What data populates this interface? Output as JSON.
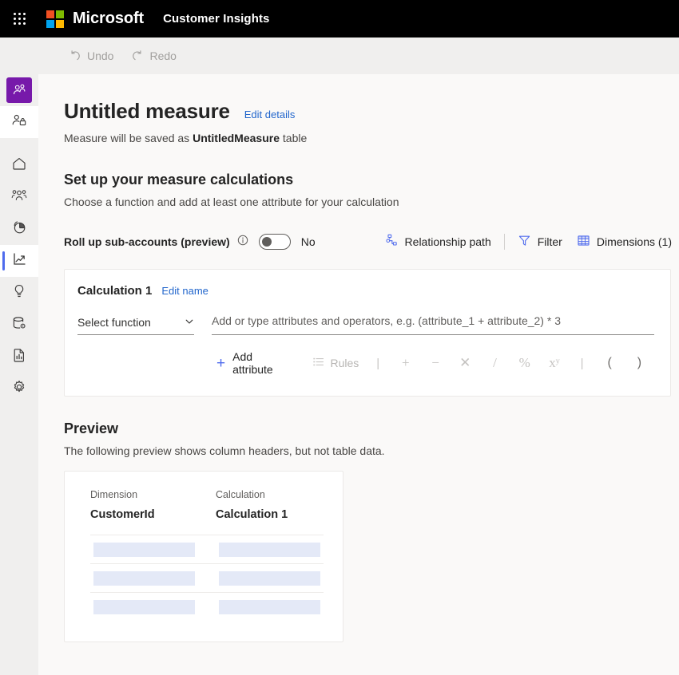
{
  "suite": {
    "waffle_label": "app-launcher",
    "brand": "Microsoft",
    "app_name": "Customer Insights"
  },
  "command_bar": {
    "menu_label": "global-navigation",
    "undo_label": "Undo",
    "redo_label": "Redo"
  },
  "rail": {
    "items": [
      {
        "icon": "person-add-icon",
        "name": "sidebar-item-customer",
        "state": "accent"
      },
      {
        "icon": "person-lock-icon",
        "name": "sidebar-item-consent",
        "state": "white"
      },
      {
        "icon": "home-icon",
        "name": "sidebar-item-home",
        "state": "normal"
      },
      {
        "icon": "people-icon",
        "name": "sidebar-item-audience",
        "state": "normal"
      },
      {
        "icon": "pie-chart-icon",
        "name": "sidebar-item-insights",
        "state": "normal"
      },
      {
        "icon": "line-chart-icon",
        "name": "sidebar-item-measures",
        "state": "selected"
      },
      {
        "icon": "lightbulb-icon",
        "name": "sidebar-item-intelligence",
        "state": "normal"
      },
      {
        "icon": "database-gear-icon",
        "name": "sidebar-item-data",
        "state": "normal"
      },
      {
        "icon": "report-icon",
        "name": "sidebar-item-reports",
        "state": "normal"
      },
      {
        "icon": "gear-icon",
        "name": "sidebar-item-settings",
        "state": "normal"
      }
    ]
  },
  "page": {
    "title": "Untitled measure",
    "edit_details_label": "Edit details",
    "save_note_prefix": "Measure will be saved as ",
    "save_note_table": "UntitledMeasure",
    "save_note_suffix": " table"
  },
  "setup": {
    "heading": "Set up your measure calculations",
    "subheading": "Choose a function and add at least one attribute for your calculation",
    "rollup_label": "Roll up sub-accounts (preview)",
    "rollup_state": "No",
    "tools": {
      "relationship_path": "Relationship path",
      "filter": "Filter",
      "dimensions": "Dimensions (1)"
    }
  },
  "calculation": {
    "name": "Calculation 1",
    "edit_name_label": "Edit name",
    "function_placeholder": "Select function",
    "formula_placeholder": "Add or type attributes and operators, e.g. (attribute_1 + attribute_2) * 3",
    "add_attribute_label": "Add attribute",
    "rules_label": "Rules",
    "operators": [
      "+",
      "−",
      "✕",
      "/",
      "%",
      "xʸ",
      "(",
      ")"
    ]
  },
  "preview": {
    "heading": "Preview",
    "subheading": "The following preview shows column headers, but not table data.",
    "columns": [
      {
        "header": "Dimension",
        "name": "CustomerId"
      },
      {
        "header": "Calculation",
        "name": "Calculation 1"
      }
    ],
    "skeleton_rows": 3
  },
  "colors": {
    "accent_purple": "#7719aa",
    "selected_blue": "#4f6bed",
    "link_blue": "#2266cc",
    "suite_bar": "#000000",
    "command_bar": "#f0efee",
    "canvas": "#faf9f8",
    "skeleton": "#e4e9f7"
  }
}
